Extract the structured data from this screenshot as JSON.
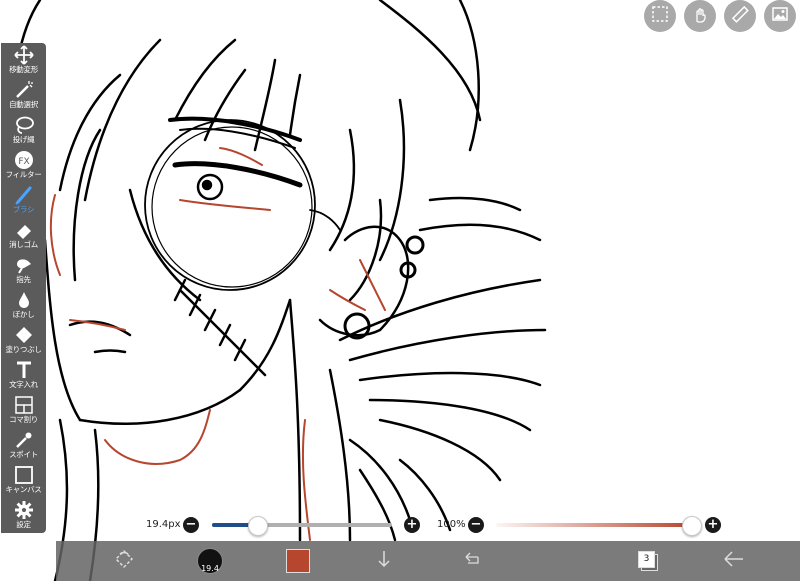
{
  "toolbar": {
    "items": [
      {
        "label": "移動変形",
        "icon": "move-icon"
      },
      {
        "label": "自動選択",
        "icon": "magic-wand-icon"
      },
      {
        "label": "投げ縄",
        "icon": "lasso-icon"
      },
      {
        "label": "フィルター",
        "icon": "fx-icon"
      },
      {
        "label": "ブラシ",
        "icon": "brush-icon",
        "active": true
      },
      {
        "label": "消しゴム",
        "icon": "eraser-icon"
      },
      {
        "label": "指先",
        "icon": "finger-icon"
      },
      {
        "label": "ぼかし",
        "icon": "blur-drop-icon"
      },
      {
        "label": "塗りつぶし",
        "icon": "fill-bucket-icon"
      },
      {
        "label": "文字入れ",
        "icon": "text-icon"
      },
      {
        "label": "コマ割り",
        "icon": "frame-divider-icon"
      },
      {
        "label": "スポイト",
        "icon": "eyedropper-icon"
      },
      {
        "label": "キャンバス",
        "icon": "canvas-icon"
      },
      {
        "label": "設定",
        "icon": "settings-gear-icon"
      }
    ],
    "active_color": "#4aa3ff"
  },
  "top_buttons": [
    "selection-icon",
    "hand-gesture-icon",
    "ruler-icon",
    "image-icon"
  ],
  "brush": {
    "size_label": "19.4px",
    "size_level": 0.25,
    "opacity_label": "100%",
    "opacity_level": 1.0
  },
  "bottom_bar": {
    "brush_preview_value": "19.4",
    "current_color": "#b7462f",
    "layer_count": "3"
  },
  "colors": {
    "toolbar_bg": "#5b5b5b",
    "line_art": "#000000",
    "skin_line": "#b7462f"
  }
}
